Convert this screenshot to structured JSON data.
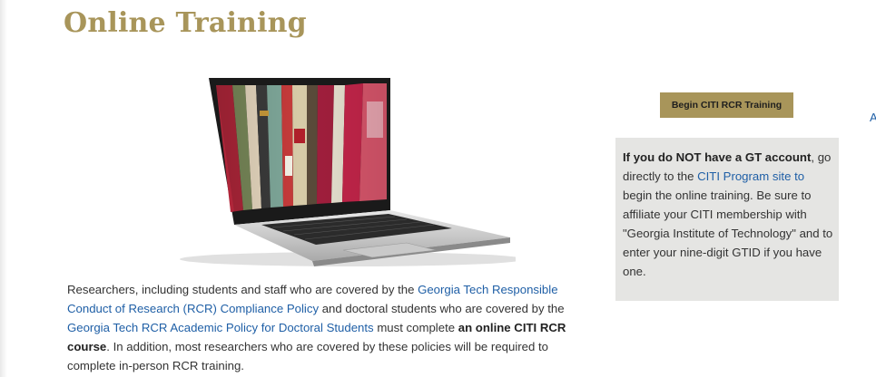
{
  "header": {
    "title": "Online Training"
  },
  "main": {
    "paragraph": {
      "t1": "Researchers, including students and staff who are covered by the ",
      "link1": "Georgia Tech Responsible Conduct of Research (RCR) Compliance Policy",
      "t2": " and doctoral students who are covered by the ",
      "link2": "Georgia Tech RCR Academic Policy for Doctoral Students",
      "t3": " must complete ",
      "bold": "an online CITI RCR course",
      "t4": ". In addition, most researchers who are covered by these policies will be required to complete in-person RCR training."
    }
  },
  "sidebar": {
    "cta_label": "Begin CITI RCR Training",
    "note": {
      "bold": "If you do NOT have a GT account",
      "t1": ", go directly to the ",
      "link": "CITI Program site to",
      "t2": " begin the online training. Be sure to affiliate your CITI membership with \"Georgia Institute of Technology\" and to enter your nine-digit GTID if you have one."
    }
  },
  "edge_glyph": "A",
  "colors": {
    "accent_gold": "#a8955a",
    "link_blue": "#1f5fa6",
    "panel_gray": "#e5e5e3",
    "text": "#333333"
  },
  "illustration": "laptop-with-books-on-screen"
}
